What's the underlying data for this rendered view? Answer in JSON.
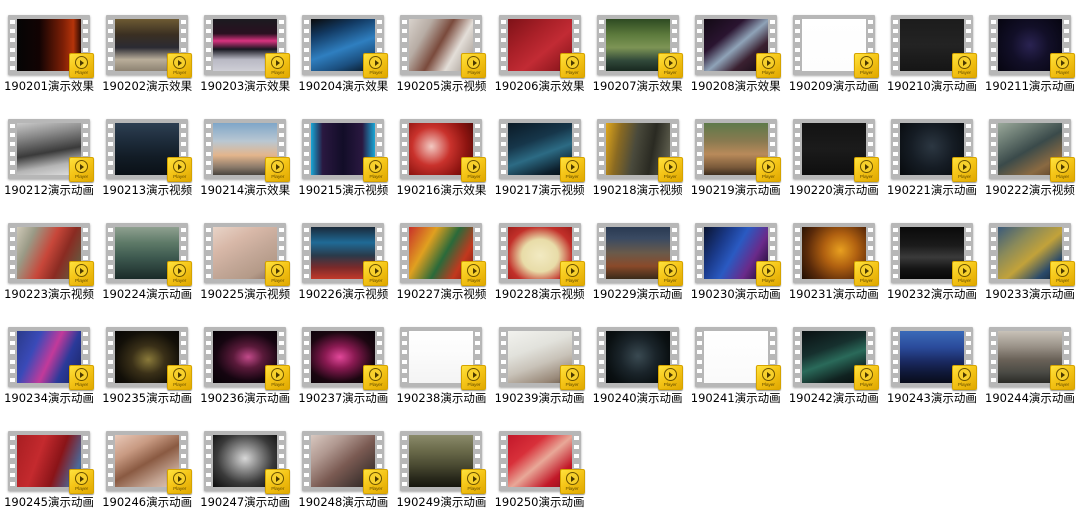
{
  "view": {
    "kind": "file-explorer-thumbnail-grid",
    "columns": 11,
    "rows": 5,
    "item_count": 50,
    "badge": {
      "icon": "play-circle-icon",
      "text": "Player",
      "color": "#f5c518"
    },
    "background": "#ffffff",
    "label_color": "#000000"
  },
  "items": [
    {
      "label": "190201演示效果",
      "art": "linear-gradient(90deg,#050505 0%,#120303 35%,#7d1f06 72%,#b4340a 88%,#2a0a03 100%)"
    },
    {
      "label": "190202演示效果",
      "art": "linear-gradient(180deg,#6d5a33 0%,#3a2f22 30%,#2b2b33 55%,#b9ae9a 78%,#8d8272 100%)"
    },
    {
      "label": "190203演示效果",
      "art": "linear-gradient(180deg,#1b1b20 0%,#2a1020 28%,#d8337f 42%,#171720 58%,#b9b9c4 78%,#cfcfd6 100%)"
    },
    {
      "label": "190204演示效果",
      "art": "linear-gradient(160deg,#0a0a0a 0%,#123a63 25%,#2f7fc0 55%,#1b4f7f 78%,#07121c 100%)"
    },
    {
      "label": "190205演示视频",
      "art": "linear-gradient(120deg,#d8d2cc 0%,#b7aca4 25%,#7a4a3c 48%,#e3ded8 70%,#9a8f86 100%)"
    },
    {
      "label": "190206演示效果",
      "art": "linear-gradient(140deg,#7e1218 0%,#a92028 35%,#c22b34 60%,#7d1016 100%)"
    },
    {
      "label": "190207演示效果",
      "art": "linear-gradient(180deg,#2e4a22 0%,#5c7a3c 30%,#7d9455 55%,#31493a 80%,#18281f 100%)"
    },
    {
      "label": "190208演示效果",
      "art": "linear-gradient(140deg,#120a14 0%,#2a1430 32%,#8fa3b8 52%,#3a2030 72%,#0d0710 100%)"
    },
    {
      "label": "190209演示动画",
      "art": "linear-gradient(180deg,#ffffff 0%,#fdfdfd 100%)"
    },
    {
      "label": "190210演示动画",
      "art": "linear-gradient(180deg,#1c1c1c 0%,#232323 50%,#151515 100%)"
    },
    {
      "label": "190211演示动画",
      "art": "radial-gradient(circle at 50% 50%,#2a2352 0%,#120f28 45%,#060510 100%)"
    },
    {
      "label": "190212演示动画",
      "art": "linear-gradient(170deg,#c9c9c9 0%,#8a8a8a 25%,#3a3a3a 55%,#b5b5b5 78%,#e2e2e2 100%)"
    },
    {
      "label": "190213演示视频",
      "art": "linear-gradient(180deg,#2d3f52 0%,#1d2b3a 35%,#121c26 65%,#0a1016 100%)"
    },
    {
      "label": "190214演示效果",
      "art": "linear-gradient(180deg,#7fa6c8 0%,#b9c7d2 35%,#e3b58c 62%,#8a7a6a 85%,#4a443e 100%)"
    },
    {
      "label": "190215演示视频",
      "art": "linear-gradient(90deg,#19a7d6 0%,#2a1840 18%,#120d28 50%,#2a1840 80%,#19a7d6 100%)"
    },
    {
      "label": "190216演示效果",
      "art": "radial-gradient(circle at 35% 45%,#f2c9c2 0%,#c9322c 38%,#8d1410 70%,#4d0806 100%)"
    },
    {
      "label": "190217演示视频",
      "art": "linear-gradient(160deg,#0b1a26 0%,#16364a 35%,#2c6b84 58%,#0d1f2c 85%,#060d13 100%)"
    },
    {
      "label": "190218演示视频",
      "art": "linear-gradient(100deg,#e0a81c 0%,#8a6a22 22%,#4a4a3c 45%,#2a2a22 70%,#6a6a58 100%)"
    },
    {
      "label": "190219演示动画",
      "art": "linear-gradient(180deg,#5e7a4a 0%,#8a7a50 35%,#b98a5a 60%,#7a5a3a 85%,#3e2e1e 100%)"
    },
    {
      "label": "190220演示动画",
      "art": "linear-gradient(180deg,#131313 0%,#1b1b1b 50%,#0e0e0e 100%)"
    },
    {
      "label": "190221演示动画",
      "art": "radial-gradient(circle at 50% 45%,#2c3742 0%,#151c24 50%,#070a0d 100%)"
    },
    {
      "label": "190222演示视频",
      "art": "linear-gradient(150deg,#9aa89a 0%,#6a7a72 25%,#3a4a4a 50%,#8a6a42 78%,#5a3f26 100%)"
    },
    {
      "label": "190223演示视频",
      "art": "linear-gradient(115deg,#cfc9b8 0%,#9a9a86 22%,#c8473a 48%,#8a2b22 68%,#5a6a4a 100%)"
    },
    {
      "label": "190224演示动画",
      "art": "linear-gradient(180deg,#8fa090 0%,#5e7a68 30%,#3e5a50 58%,#2a3f3a 82%,#1a2a28 100%)"
    },
    {
      "label": "190225演示视频",
      "art": "linear-gradient(150deg,#e8d4c8 0%,#d8b8a8 30%,#c4a898 55%,#b49a88 80%,#8a7062 100%)"
    },
    {
      "label": "190226演示视频",
      "art": "linear-gradient(180deg,#1a2a3a 0%,#1f6a96 30%,#2a3a4a 55%,#7a2a2a 78%,#c23a2a 100%)"
    },
    {
      "label": "190227演示视频",
      "art": "linear-gradient(120deg,#c8302a 0%,#e0a020 30%,#2a6a3a 55%,#c2381e 78%,#7a1a12 100%)"
    },
    {
      "label": "190228演示视频",
      "art": "radial-gradient(ellipse at 50% 55%,#f2eac2 0%,#e8dca8 40%,#c2302a 72%,#a01e1a 100%)"
    },
    {
      "label": "190229演示动画",
      "art": "linear-gradient(180deg,#2a3a52 0%,#3a4a62 22%,#6a5a4a 50%,#8a4a2a 75%,#3a2a1a 100%)"
    },
    {
      "label": "190230演示动画",
      "art": "linear-gradient(120deg,#0a1430 0%,#1a3a8a 28%,#2a5ac2 48%,#6a2a8a 72%,#10081f 100%)"
    },
    {
      "label": "190231演示动画",
      "art": "radial-gradient(circle at 60% 45%,#e8a020 0%,#b06010 35%,#5a2a0a 70%,#1f0f04 100%)"
    },
    {
      "label": "190232演示动画",
      "art": "linear-gradient(180deg,#0a0a0a 0%,#1a1a1a 35%,#3a3a3a 58%,#151515 80%,#080808 100%)"
    },
    {
      "label": "190233演示动画",
      "art": "linear-gradient(140deg,#3a5a7a 0%,#8a8a5a 30%,#c2a23a 55%,#2a4a6a 80%,#12202e 100%)"
    },
    {
      "label": "190234演示动画",
      "art": "linear-gradient(115deg,#2a3a8a 0%,#3a4ab8 28%,#c23a9a 52%,#2a3a9a 72%,#1a2460 100%)"
    },
    {
      "label": "190235演示动画",
      "art": "radial-gradient(ellipse at 52% 55%,#8a7a3a 0%,#3a3018 35%,#120f08 70%,#060504 100%)"
    },
    {
      "label": "190236演示动画",
      "art": "radial-gradient(ellipse at 55% 50%,#c24a8a 0%,#5a1a3a 30%,#150510 65%,#060206 100%)"
    },
    {
      "label": "190237演示动画",
      "art": "radial-gradient(ellipse at 45% 50%,#e2489a 0%,#8a1a52 30%,#1a0610 68%,#080308 100%)"
    },
    {
      "label": "190238演示动画",
      "art": "linear-gradient(180deg,#ffffff 0%,#fbfbfb 45%,#f4f4f4 100%)"
    },
    {
      "label": "190239演示动画",
      "art": "linear-gradient(160deg,#f2f2ee 0%,#e2e2dc 35%,#c8c2b8 60%,#9a8a7a 85%,#6a5a4a 100%)"
    },
    {
      "label": "190240演示动画",
      "art": "radial-gradient(circle at 50% 48%,#3a4a52 0%,#1a242a 42%,#0a1012 75%,#050809 100%)"
    },
    {
      "label": "190241演示动画",
      "art": "linear-gradient(180deg,#ffffff 0%,#fafafa 100%)"
    },
    {
      "label": "190242演示动画",
      "art": "linear-gradient(160deg,#0a1012 0%,#16302e 35%,#2a6a5a 55%,#102220 80%,#060c0c 100%)"
    },
    {
      "label": "190243演示动画",
      "art": "linear-gradient(180deg,#3a6ab8 0%,#2a4a9a 32%,#1a2a62 58%,#0f1838 80%,#080c1a 100%)"
    },
    {
      "label": "190244演示动画",
      "art": "linear-gradient(180deg,#c8c2b8 0%,#9a9288 30%,#6a6258 55%,#4a4a44 80%,#2a2a26 100%)"
    },
    {
      "label": "190245演示动画",
      "art": "linear-gradient(110deg,#a81e22 0%,#c42a2e 35%,#8a1418 62%,#4a6a9a 88%,#2a4a7a 100%)"
    },
    {
      "label": "190246演示动画",
      "art": "linear-gradient(150deg,#e8c8b8 0%,#c89a82 28%,#8a5a42 52%,#c2a290 78%,#e0cabc 100%)"
    },
    {
      "label": "190247演示动画",
      "art": "radial-gradient(ellipse at 50% 45%,#d8d8d8 0%,#8a8a8a 30%,#3a3a3a 62%,#0c0c0c 100%)"
    },
    {
      "label": "190248演示动画",
      "art": "linear-gradient(140deg,#d8c8c0 0%,#b09890 28%,#7a5a52 55%,#4a3a36 80%,#2a2220 100%)"
    },
    {
      "label": "190249演示动画",
      "art": "linear-gradient(180deg,#8a8a6a 0%,#6a6a4a 30%,#4a4a32 58%,#2a2a1c 82%,#16160e 100%)"
    },
    {
      "label": "190250演示动画",
      "art": "linear-gradient(140deg,#c2182a 0%,#d8303a 30%,#e8a898 52%,#c21828 78%,#8a0e1c 100%)"
    }
  ]
}
